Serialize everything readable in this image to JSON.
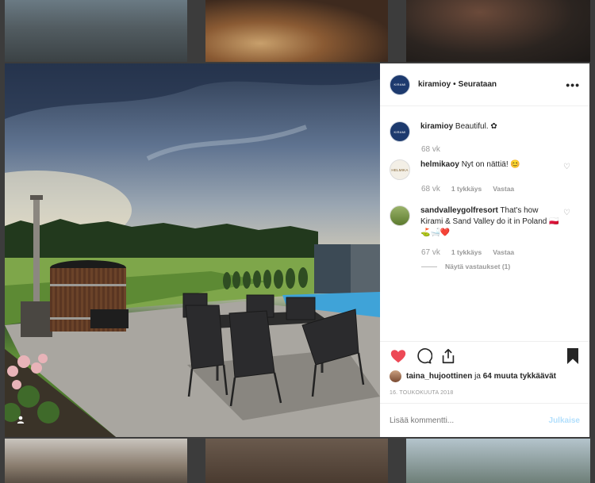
{
  "post": {
    "username": "kiramioy",
    "separator": "•",
    "follow_status": "Seurataan",
    "more_label": "•••",
    "avatar_text": "KIRAMI"
  },
  "comments": [
    {
      "username": "kiramioy",
      "text": "Beautiful. ✿",
      "time": "68 vk",
      "likes": "",
      "reply": "",
      "avatar_text": "KIRAMI"
    },
    {
      "username": "helmikaoy",
      "text": "Nyt on nättiä! 😊",
      "time": "68 vk",
      "likes": "1 tykkäys",
      "reply": "Vastaa",
      "avatar_text": "HELMIKA"
    },
    {
      "username": "sandvalleygolfresort",
      "text": "That's how Kirami & Sand Valley do it in Poland 🇵🇱⛳️🛁❤️",
      "time": "67 vk",
      "likes": "1 tykkäys",
      "reply": "Vastaa",
      "avatar_text": ""
    }
  ],
  "view_replies": "Näytä vastaukset (1)",
  "likes": {
    "user": "taina_hujoottinen",
    "mid": " ja ",
    "count_text": "64 muuta tykkäävät"
  },
  "date": "16. TOUKOKUUTA 2018",
  "add_comment": {
    "placeholder": "Lisää kommentti...",
    "post_label": "Julkaise"
  },
  "colors": {
    "like_red": "#ed4956",
    "text": "#262626",
    "muted": "#999999",
    "post_blue": "#b2dffc"
  },
  "icons": [
    "heart-icon",
    "comment-icon",
    "share-icon",
    "bookmark-icon",
    "more-icon",
    "user-tag-icon"
  ]
}
